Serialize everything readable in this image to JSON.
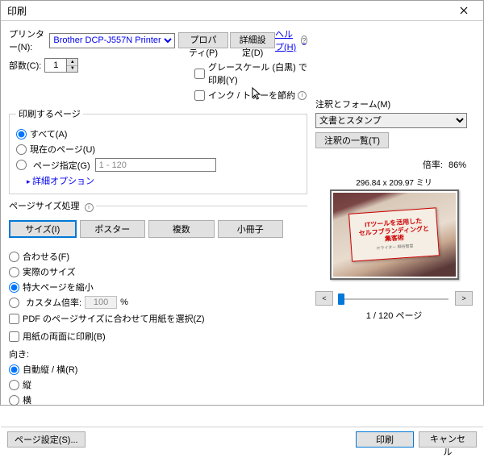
{
  "titlebar": {
    "title": "印刷"
  },
  "printer": {
    "label": "プリンター(N):",
    "selected": "Brother DCP-J557N Printer"
  },
  "buttons": {
    "properties": "プロパティ(P)",
    "advanced": "詳細設定(D)",
    "pageSetup": "ページ設定(S)...",
    "print": "印刷",
    "cancel": "キャンセル",
    "annotList": "注釈の一覧(T)"
  },
  "help": {
    "label": "ヘルプ(H)",
    "mark": "?"
  },
  "copies": {
    "label": "部数(C):",
    "value": "1"
  },
  "options": {
    "grayscale": "グレースケール (白黒) で印刷(Y)",
    "saveInk": "インク / トナーを節約",
    "info": "i"
  },
  "pages": {
    "legend": "印刷するページ",
    "all": "すべて(A)",
    "current": "現在のページ(U)",
    "range": "ページ指定(G)",
    "rangePlaceholder": "1 - 120",
    "adv": "詳細オプション"
  },
  "sizing": {
    "legend": "ページサイズ処理",
    "info": "i",
    "size": "サイズ(I)",
    "poster": "ポスター",
    "multi": "複数",
    "booklet": "小冊子",
    "fit": "合わせる(F)",
    "actual": "実際のサイズ",
    "shrink": "特大ページを縮小",
    "custom": "カスタム倍率:",
    "customVal": "100",
    "pct": "%",
    "pdfSize": "PDF のページサイズに合わせて用紙を選択(Z)",
    "duplex": "用紙の両面に印刷(B)",
    "orientLabel": "向き:",
    "autoOrient": "自動縦 / 横(R)",
    "portrait": "縦",
    "landscape": "横"
  },
  "forms": {
    "label": "注釈とフォーム(M)",
    "selected": "文書とスタンプ"
  },
  "scale": {
    "label": "倍率:",
    "value": "86%"
  },
  "preview": {
    "dim": "296.84 x 209.97 ミリ",
    "line1": "ITツールを活用した",
    "line2": "セルフブランディングと",
    "line3": "集客術",
    "sub": "ITライター 柳谷智宣"
  },
  "nav": {
    "prev": "<",
    "next": ">",
    "page": "1 / 120 ページ"
  }
}
